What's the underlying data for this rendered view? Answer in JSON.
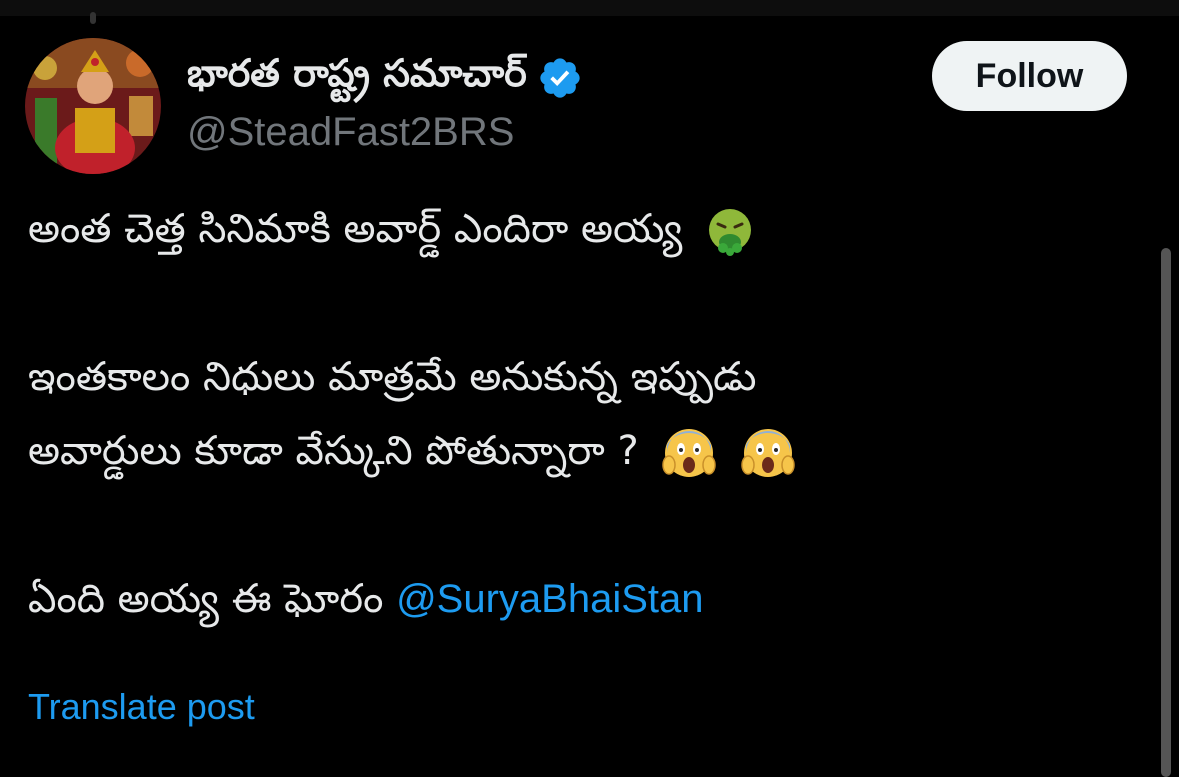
{
  "post": {
    "author": {
      "display_name": "భారత రాష్ట్ర సమాచార్",
      "handle": "@SteadFast2BRS",
      "verified": true,
      "verified_color": "#1d9bf0",
      "avatar_icon": "avatar-image"
    },
    "follow_label": "Follow",
    "lines": {
      "l1": "అంత చెత్త సినిమాకి అవార్డ్ ఎందిరా అయ్య",
      "l2": "ఇంతకాలం నిధులు మాత్రమే అనుకున్న ఇప్పుడు",
      "l3": "అవార్డులు కూడా వేస్కుని పోతున్నారా ?",
      "l4": "ఏంది అయ్య ఈ ఘోరం"
    },
    "emojis": {
      "vomit": "vomiting-face-emoji",
      "scream": "face-screaming-in-fear-emoji"
    },
    "mention": "@SuryaBhaiStan",
    "translate_label": "Translate post"
  },
  "colors": {
    "background": "#000000",
    "text": "#e7e9ea",
    "secondary": "#71767b",
    "accent": "#1d9bf0",
    "follow_bg": "#eff3f4"
  }
}
